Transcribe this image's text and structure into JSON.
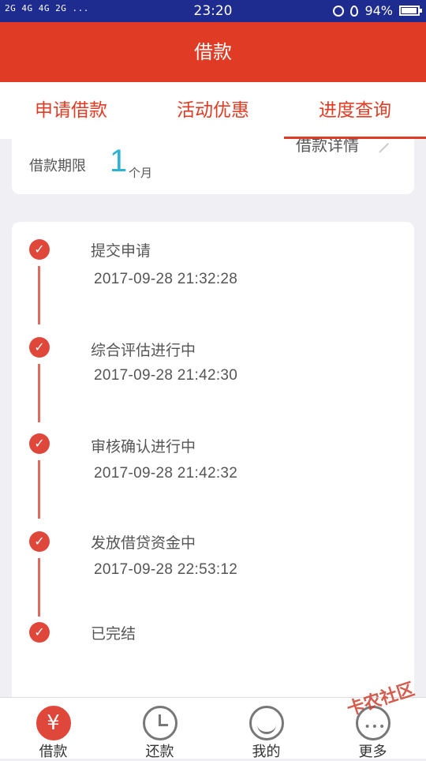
{
  "status_bar": {
    "signal": "2G 4G 4G 2G ...",
    "time": "23:20",
    "battery": "94%",
    "battery_level": 0.94
  },
  "header": {
    "title": "借款"
  },
  "tabs": [
    {
      "label": "申请借款",
      "active": false
    },
    {
      "label": "活动优惠",
      "active": false
    },
    {
      "label": "进度查询",
      "active": true
    }
  ],
  "loan": {
    "term_label": "借款期限",
    "term_value": "1",
    "term_unit": "个月",
    "detail_link": "借款详情"
  },
  "steps": [
    {
      "title": "提交申请",
      "time": "2017-09-28 21:32:28"
    },
    {
      "title": "综合评估进行中",
      "time": "2017-09-28 21:42:30"
    },
    {
      "title": "审核确认进行中",
      "time": "2017-09-28 21:42:32"
    },
    {
      "title": "发放借贷资金中",
      "time": "2017-09-28 22:53:12"
    },
    {
      "title": "已完结",
      "time": ""
    }
  ],
  "bottom_nav": [
    {
      "label": "借款",
      "icon": "yen-icon",
      "glyph": "¥",
      "active": true
    },
    {
      "label": "还款",
      "icon": "clock-icon",
      "active": false
    },
    {
      "label": "我的",
      "icon": "profile-icon",
      "active": false
    },
    {
      "label": "更多",
      "icon": "more-icon",
      "active": false
    }
  ],
  "watermark": "卡农社区",
  "colors": {
    "brand_red": "#e03c25",
    "status_bar": "#1f2c8f",
    "term_blue": "#2bb3d6",
    "check_red": "#e0473b"
  }
}
